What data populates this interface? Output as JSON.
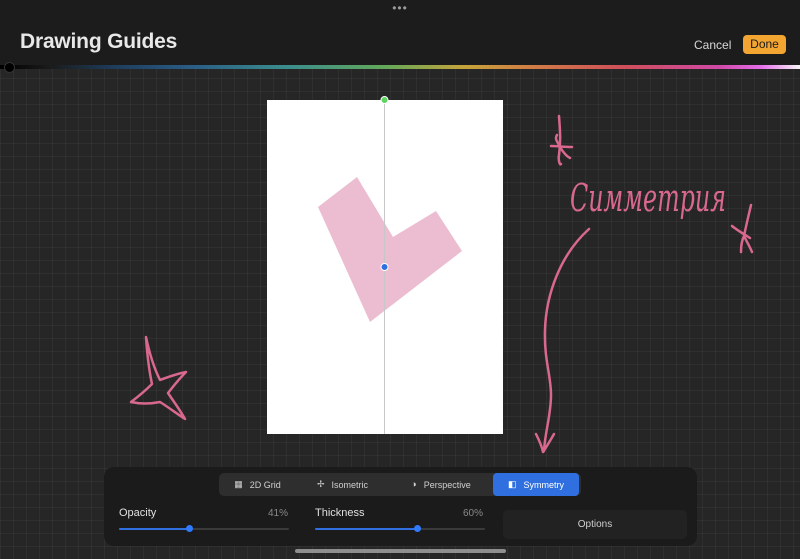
{
  "header": {
    "title": "Drawing Guides",
    "cancel_label": "Cancel",
    "done_label": "Done",
    "more_glyph": "•••"
  },
  "colors": {
    "accent": "#2f6fe0",
    "done_bg": "#f2a531",
    "ink": "#d9688e",
    "shape_fill": "#ecbdd0"
  },
  "annotation": {
    "handwritten_text": "Симметрия"
  },
  "guide_tabs": [
    {
      "label": "2D Grid",
      "icon": "grid-icon",
      "glyph": "▦",
      "active": false
    },
    {
      "label": "Isometric",
      "icon": "isometric-icon",
      "glyph": "✢",
      "active": false
    },
    {
      "label": "Perspective",
      "icon": "perspective-icon",
      "glyph": "◑",
      "active": false
    },
    {
      "label": "Symmetry",
      "icon": "symmetry-icon",
      "glyph": "◧",
      "active": true
    }
  ],
  "sliders": {
    "opacity": {
      "label": "Opacity",
      "value_text": "41%",
      "value": 0.41
    },
    "thickness": {
      "label": "Thickness",
      "value_text": "60%",
      "value": 0.6
    }
  },
  "options_label": "Options"
}
